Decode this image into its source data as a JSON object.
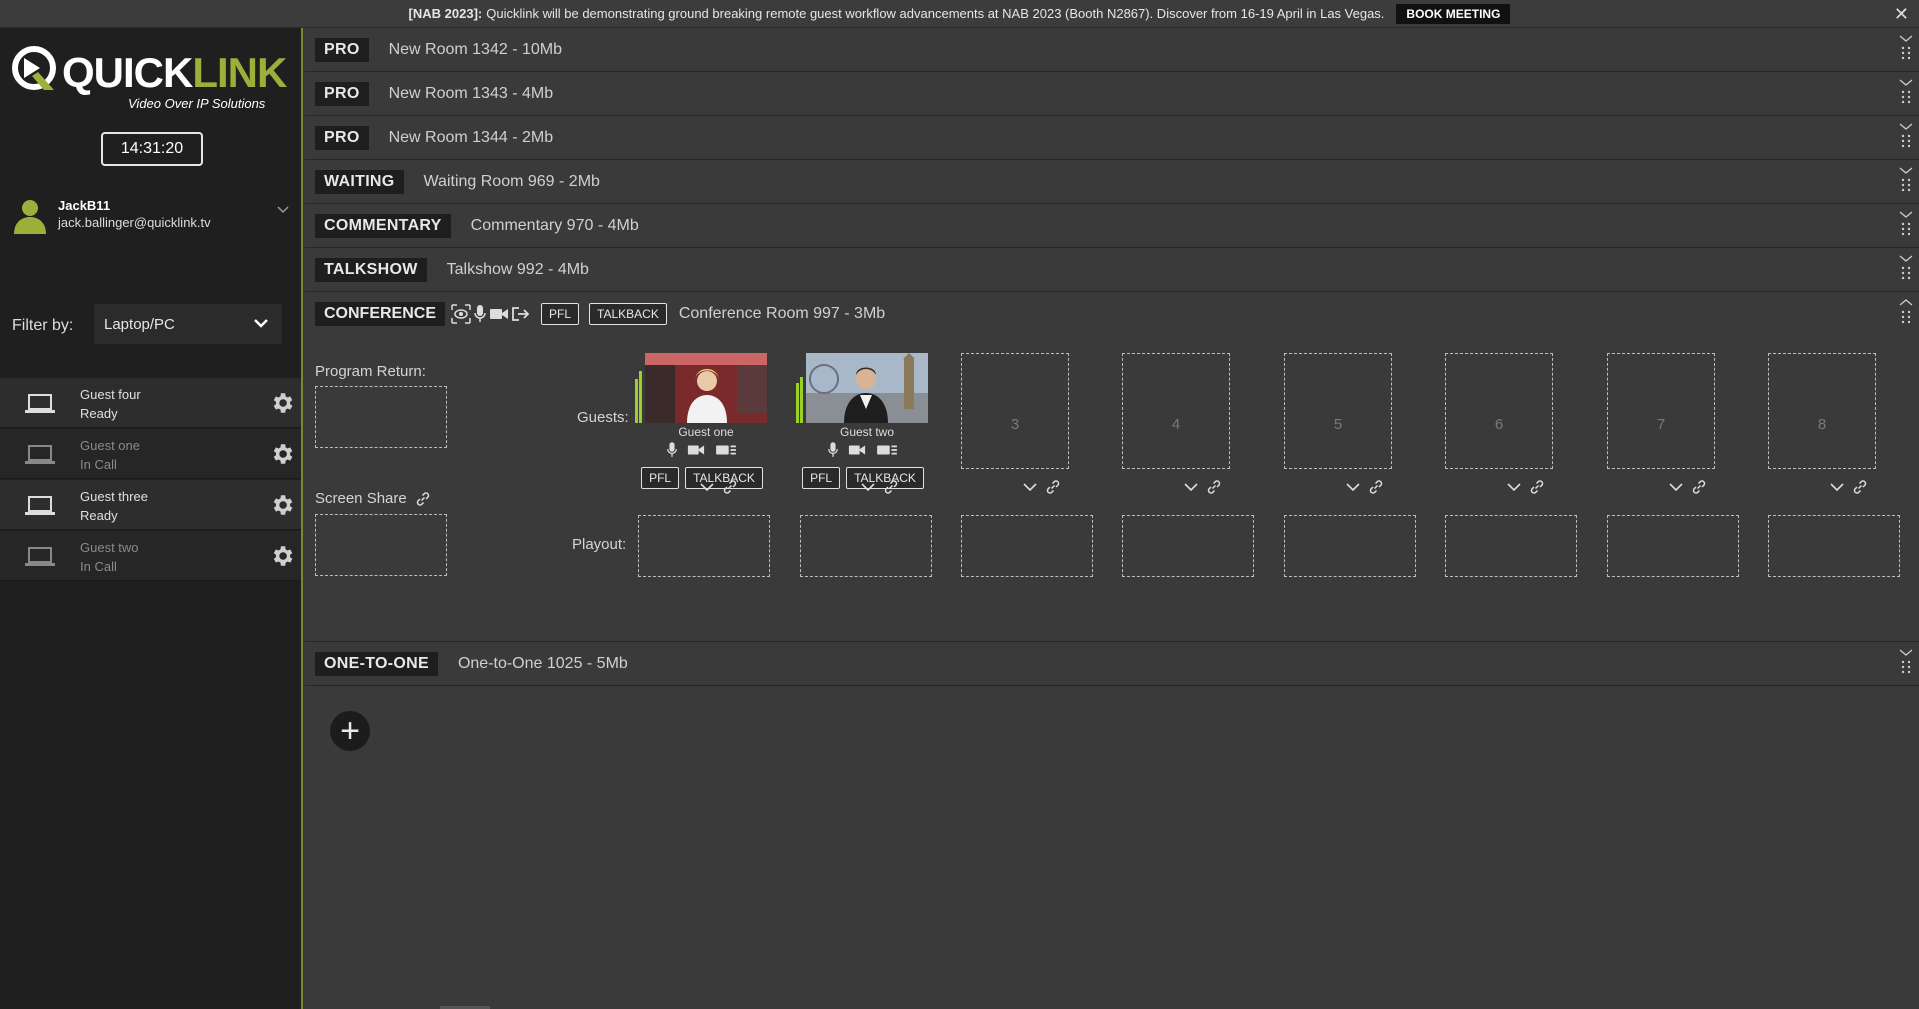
{
  "banner": {
    "prefix": "[NAB 2023]:",
    "message": "Quicklink will be demonstrating ground breaking remote guest workflow advancements at NAB 2023 (Booth N2867). Discover from 16-19 April in Las Vegas.",
    "button": "BOOK MEETING",
    "close": "✕"
  },
  "logo": {
    "quick": "QUICK",
    "link": "LINK",
    "subtitle": "Video Over IP Solutions"
  },
  "clock": "14:31:20",
  "user": {
    "name": "JackB11",
    "email": "jack.ballinger@quicklink.tv"
  },
  "filter": {
    "label": "Filter by:",
    "value": "Laptop/PC"
  },
  "guests": [
    {
      "name": "Guest four",
      "status": "Ready"
    },
    {
      "name": "Guest one",
      "status": "In Call"
    },
    {
      "name": "Guest three",
      "status": "Ready"
    },
    {
      "name": "Guest two",
      "status": "In Call"
    }
  ],
  "rooms": [
    {
      "tag": "PRO",
      "name": "New Room 1342 - 10Mb"
    },
    {
      "tag": "PRO",
      "name": "New Room 1343 - 4Mb"
    },
    {
      "tag": "PRO",
      "name": "New Room 1344 - 2Mb"
    },
    {
      "tag": "WAITING",
      "name": "Waiting Room 969 - 2Mb"
    },
    {
      "tag": "COMMENTARY",
      "name": "Commentary 970 - 4Mb"
    },
    {
      "tag": "TALKSHOW",
      "name": "Talkshow 992 - 4Mb"
    }
  ],
  "conference": {
    "tag": "CONFERENCE",
    "pfl": "PFL",
    "talkback": "TALKBACK",
    "name": "Conference Room 997 - 3Mb",
    "program_return": "Program Return:",
    "guests_label": "Guests:",
    "screen_share": "Screen Share",
    "playout_label": "Playout:",
    "tiles": [
      {
        "name": "Guest one",
        "pfl": "PFL",
        "talkback": "TALKBACK"
      },
      {
        "name": "Guest two",
        "pfl": "PFL",
        "talkback": "TALKBACK"
      }
    ],
    "empty_slots": [
      "3",
      "4",
      "5",
      "6",
      "7",
      "8"
    ]
  },
  "last_room": {
    "tag": "ONE-TO-ONE",
    "name": "One-to-One 1025 - 5Mb"
  },
  "add_button": "+",
  "colors": {
    "accent": "#9bb03b",
    "meter": "#9bd02a"
  }
}
